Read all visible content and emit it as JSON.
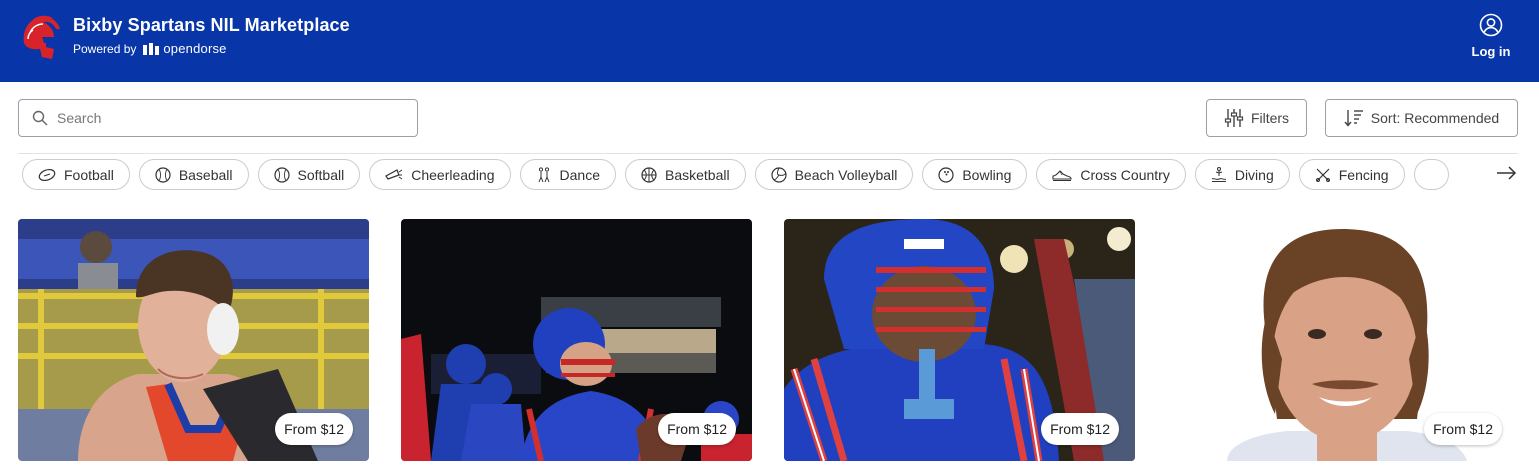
{
  "header": {
    "title": "Bixby Spartans NIL Marketplace",
    "powered_by": "Powered by",
    "partner": "opendorse",
    "login_label": "Log in",
    "brand_color": "#0836a8"
  },
  "search": {
    "placeholder": "Search",
    "value": ""
  },
  "toolbar": {
    "filters_label": "Filters",
    "sort_label": "Sort: Recommended"
  },
  "sports": [
    {
      "label": "Football",
      "icon": "football-icon"
    },
    {
      "label": "Baseball",
      "icon": "baseball-icon"
    },
    {
      "label": "Softball",
      "icon": "softball-icon"
    },
    {
      "label": "Cheerleading",
      "icon": "cheerleading-icon"
    },
    {
      "label": "Dance",
      "icon": "dance-icon"
    },
    {
      "label": "Basketball",
      "icon": "basketball-icon"
    },
    {
      "label": "Beach Volleyball",
      "icon": "volleyball-icon"
    },
    {
      "label": "Bowling",
      "icon": "bowling-icon"
    },
    {
      "label": "Cross Country",
      "icon": "running-shoe-icon"
    },
    {
      "label": "Diving",
      "icon": "diving-icon"
    },
    {
      "label": "Fencing",
      "icon": "fencing-icon"
    }
  ],
  "athletes": [
    {
      "price": "From $12",
      "photo": "wrestler-photo"
    },
    {
      "price": "From $12",
      "photo": "football-team-photo"
    },
    {
      "price": "From $12",
      "photo": "football-helmet-photo"
    },
    {
      "price": "From $12",
      "photo": "football-portrait-photo"
    }
  ]
}
